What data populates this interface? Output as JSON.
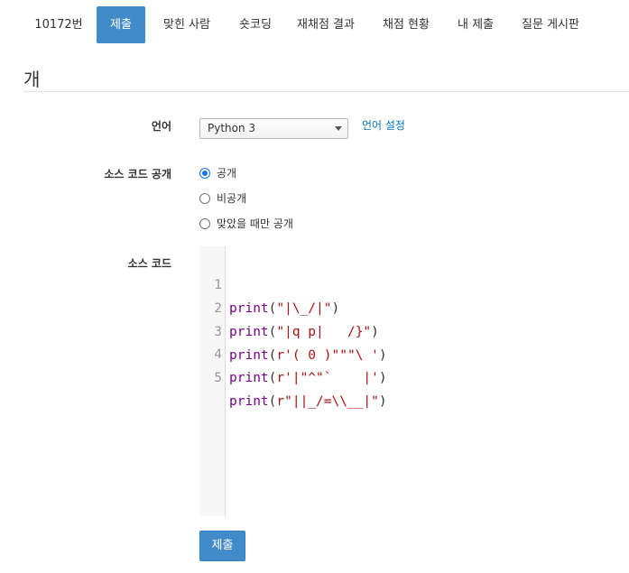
{
  "nav": {
    "tabs": [
      {
        "label": "10172번",
        "active": false
      },
      {
        "label": "제출",
        "active": true
      },
      {
        "label": "맞힌 사람",
        "active": false
      },
      {
        "label": "숏코딩",
        "active": false
      },
      {
        "label": "재채점 결과",
        "active": false
      },
      {
        "label": "채점 현황",
        "active": false
      },
      {
        "label": "내 제출",
        "active": false
      },
      {
        "label": "질문 게시판",
        "active": false
      }
    ]
  },
  "page_title": "개",
  "form": {
    "language_label": "언어",
    "language_value": "Python 3",
    "language_settings_link": "언어 설정",
    "visibility_label": "소스 코드 공개",
    "visibility_options": [
      {
        "label": "공개",
        "checked": true
      },
      {
        "label": "비공개",
        "checked": false
      },
      {
        "label": "맞았을 때만 공개",
        "checked": false
      }
    ],
    "source_label": "소스 코드",
    "code_lines": [
      {
        "num": "1",
        "fn": "print",
        "open": "(",
        "str": "\"|\\_/|\"",
        "close": ")"
      },
      {
        "num": "2",
        "fn": "print",
        "open": "(",
        "str": "\"|q p|   /}\"",
        "close": ")"
      },
      {
        "num": "3",
        "fn": "print",
        "open": "(",
        "str": "r'( 0 )\"\"\"\\ '",
        "close": ")"
      },
      {
        "num": "4",
        "fn": "print",
        "open": "(",
        "str": "r'|\"^\"`    |'",
        "close": ")"
      },
      {
        "num": "5",
        "fn": "print",
        "open": "(",
        "str": "r\"||_/=\\\\__|\"",
        "close": ")"
      }
    ],
    "submit_label": "제출"
  },
  "colors": {
    "accent": "#428bca",
    "link": "#0076c0",
    "keyword": "#770088",
    "string": "#aa1111"
  }
}
